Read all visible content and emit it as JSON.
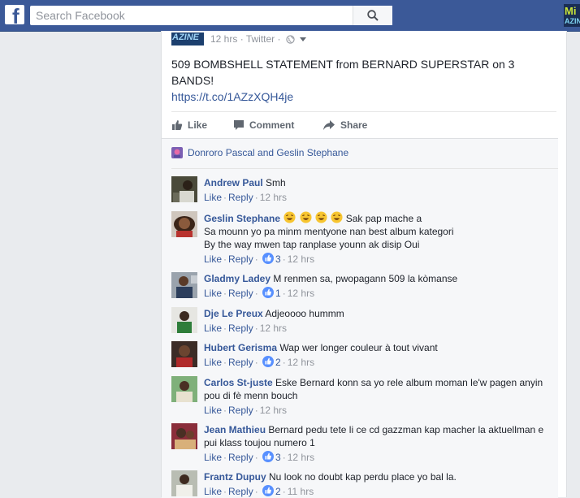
{
  "topbar": {
    "search_placeholder": "Search Facebook",
    "right_thumb_line1": "Mi",
    "right_thumb_line2": "AZIN"
  },
  "post": {
    "avatar_text": "AZINE",
    "time": "12 hrs",
    "source": "Twitter",
    "text": "509 BOMBSHELL STATEMENT from BERNARD SUPERSTAR on 3 BANDS!",
    "link": "https://t.co/1AZzXQH4je"
  },
  "actions": {
    "like": "Like",
    "comment": "Comment",
    "share": "Share"
  },
  "likers": {
    "text": "Donroro Pascal and Geslin Stephane"
  },
  "comments": [
    {
      "author": "Andrew Paul",
      "lines": [
        "Smh"
      ],
      "like": "Like",
      "reply": "Reply",
      "likes": "",
      "time": "12 hrs",
      "emoji_count": 0
    },
    {
      "author": "Geslin Stephane",
      "lines": [
        "Sak pap mache a",
        "Sa mounn yo pa minm mentyone nan best album kategori",
        "By the way mwen tap ranplase younn ak disip Oui"
      ],
      "like": "Like",
      "reply": "Reply",
      "likes": "3",
      "time": "12 hrs",
      "emoji_count": 4
    },
    {
      "author": "Gladmy Ladey",
      "lines": [
        "M renmen sa, pwopagann 509 la kòmanse"
      ],
      "like": "Like",
      "reply": "Reply",
      "likes": "1",
      "time": "12 hrs",
      "emoji_count": 0
    },
    {
      "author": "Dje Le Preux",
      "lines": [
        "Adjeoooo hummm"
      ],
      "like": "Like",
      "reply": "Reply",
      "likes": "",
      "time": "12 hrs",
      "emoji_count": 0
    },
    {
      "author": "Hubert Gerisma",
      "lines": [
        "Wap wer longer couleur à tout vivant"
      ],
      "like": "Like",
      "reply": "Reply",
      "likes": "2",
      "time": "12 hrs",
      "emoji_count": 0
    },
    {
      "author": "Carlos St-juste",
      "lines": [
        "Eske Bernard konn sa yo rele album moman le'w pagen anyin",
        "pou di fè menn bouch"
      ],
      "like": "Like",
      "reply": "Reply",
      "likes": "",
      "time": "12 hrs",
      "emoji_count": 0
    },
    {
      "author": "Jean Mathieu",
      "lines": [
        "Bernard pedu tete li ce cd gazzman kap macher la aktuellman e",
        "pui klass toujou numero 1"
      ],
      "like": "Like",
      "reply": "Reply",
      "likes": "3",
      "time": "12 hrs",
      "emoji_count": 0
    },
    {
      "author": "Frantz Dupuy",
      "lines": [
        "Nu look no doubt kap perdu place yo bal la."
      ],
      "like": "Like",
      "reply": "Reply",
      "likes": "2",
      "time": "11 hrs",
      "emoji_count": 0
    }
  ],
  "colors": {
    "brand": "#3b5998",
    "link": "#365899",
    "meta": "#90949c",
    "background": "#e9ebee"
  }
}
